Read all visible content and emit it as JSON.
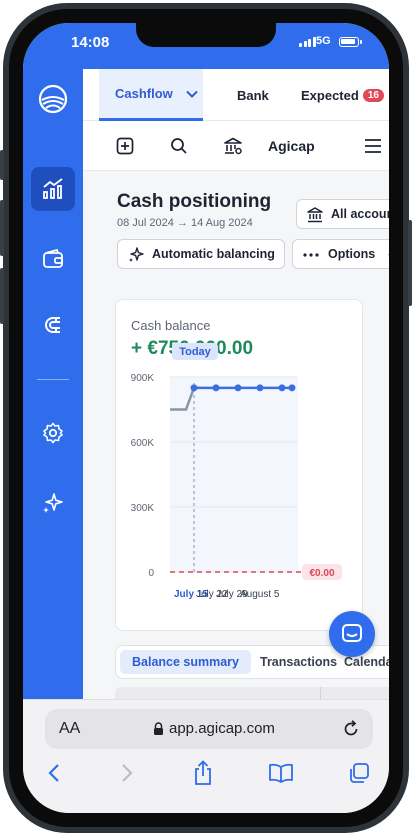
{
  "status_bar": {
    "time": "14:08",
    "network": "5G"
  },
  "tabs": [
    {
      "label": "Cashflow"
    },
    {
      "label": "Bank"
    },
    {
      "label": "Expected",
      "badge": "16"
    }
  ],
  "toolbar": {
    "label": "Agicap"
  },
  "page": {
    "title": "Cash positioning",
    "date_range": "08 Jul 2024 → 14 Aug 2024",
    "accounts_button": "All accounts",
    "auto_balancing_button": "Automatic balancing",
    "options_button": "Options"
  },
  "card": {
    "label": "Cash balance",
    "value": "+ €750,000.00"
  },
  "chart_data": {
    "type": "line",
    "title": "",
    "y_tick_labels": [
      "900K",
      "600K",
      "300K",
      "0"
    ],
    "ylim": [
      0,
      900000
    ],
    "today_marker": "Today",
    "x_tick_labels": [
      "July 15",
      "July 22",
      "July 29",
      "August 5"
    ],
    "series": [
      {
        "values": [
          750000,
          750000,
          850000,
          850000,
          850000,
          850000,
          850000,
          850000
        ]
      }
    ],
    "threshold_label": "€0.00",
    "threshold_value": 0,
    "colors": {
      "line": "#3b6fe0",
      "past_line": "#8a94a6",
      "threshold": "#d7485b"
    }
  },
  "segments": {
    "balance_summary": "Balance summary",
    "transactions": "Transactions",
    "calendar": "Calendar"
  },
  "browser": {
    "aa": "AA",
    "url": "app.agicap.com"
  },
  "colors": {
    "brand": "#2f6ded",
    "positive": "#1e8a5c",
    "badge": "#e04a58"
  }
}
